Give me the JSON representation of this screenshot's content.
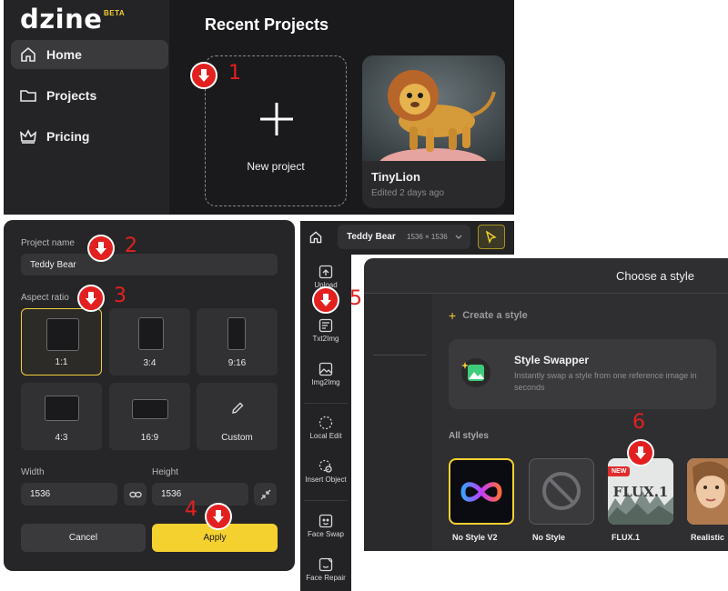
{
  "sidebar": {
    "logo": "dzine",
    "badge": "BETA",
    "items": [
      {
        "label": "Home",
        "icon": "home-icon",
        "active": true
      },
      {
        "label": "Projects",
        "icon": "folder-icon",
        "active": false
      },
      {
        "label": "Pricing",
        "icon": "crown-icon",
        "active": false
      }
    ]
  },
  "recent": {
    "title": "Recent Projects",
    "new_project_label": "New project",
    "projects": [
      {
        "title": "TinyLion",
        "subtitle": "Edited 2 days ago"
      }
    ]
  },
  "dialog": {
    "name_label": "Project name",
    "name_value": "Teddy Bear",
    "ratio_label": "Aspect ratio",
    "ratios": [
      "1:1",
      "3:4",
      "9:16",
      "4:3",
      "16:9",
      "Custom"
    ],
    "selected_ratio": "1:1",
    "width_label": "Width",
    "width_value": "1536",
    "height_label": "Height",
    "height_value": "1536",
    "cancel_label": "Cancel",
    "apply_label": "Apply"
  },
  "editor": {
    "project_name": "Teddy Bear",
    "dimensions": "1536 × 1536",
    "tools": [
      "Upload",
      "Txt2Img",
      "Img2Img",
      "Local Edit",
      "Insert Object",
      "Face Swap",
      "Face Repair"
    ]
  },
  "styles": {
    "title": "Choose a style",
    "create_label": "Create a style",
    "swapper_title": "Style Swapper",
    "swapper_desc": "Instantly swap a style from one reference image in seconds",
    "all_label": "All styles",
    "cards": [
      {
        "name": "No Style V2",
        "selected": true
      },
      {
        "name": "No Style",
        "selected": false
      },
      {
        "name": "FLUX.1",
        "badge": "NEW",
        "art_text": "FLUX.1"
      },
      {
        "name": "Realistic",
        "selected": false
      }
    ]
  },
  "annotations": [
    "1",
    "2",
    "3",
    "4",
    "5",
    "6"
  ],
  "colors": {
    "accent": "#f5d130",
    "marker": "#e32020"
  }
}
